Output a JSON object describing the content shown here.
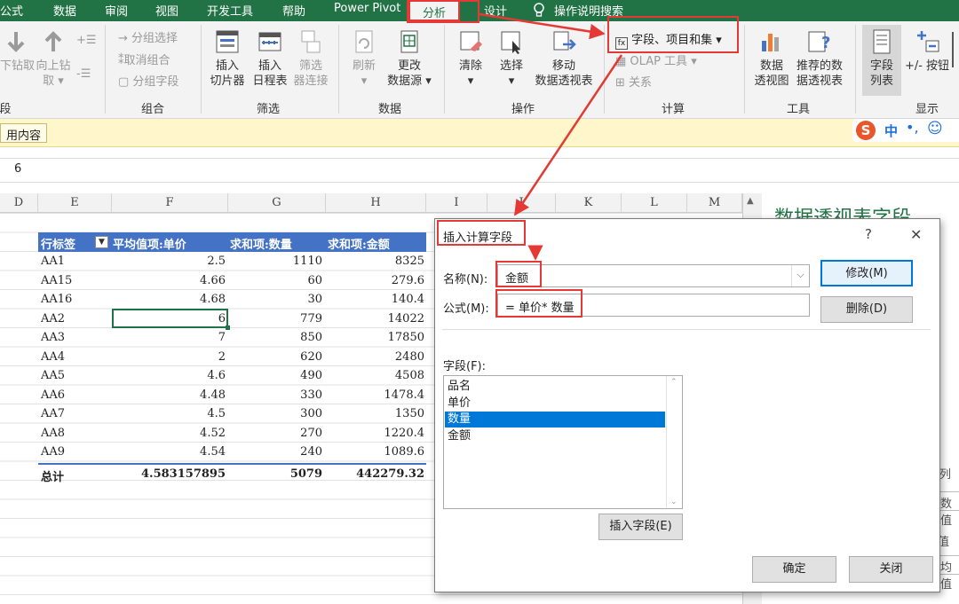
{
  "menu": {
    "tabs": [
      "公式",
      "数据",
      "审阅",
      "视图",
      "开发工具",
      "帮助",
      "Power Pivot",
      "分析",
      "设计"
    ],
    "active_tab": "分析",
    "tell_me": "操作说明搜索"
  },
  "ribbon": {
    "groups": {
      "g_left": "段",
      "group": "组合",
      "filter": "筛选",
      "data": "数据",
      "actions": "操作",
      "calc": "计算",
      "tools": "工具",
      "show": "显示"
    },
    "drill_down": "下钻取",
    "drill_up_1": "向上钻",
    "drill_up_2": "取 ▾",
    "group_selection": "→ 分组选择",
    "ungroup": "取消组合",
    "group_field": "分组字段",
    "insert_slicer_1": "插入",
    "insert_slicer_2": "切片器",
    "insert_timeline_1": "插入",
    "insert_timeline_2": "日程表",
    "filter_conn_1": "筛选",
    "filter_conn_2": "器连接",
    "refresh_1": "刷新",
    "refresh_2": "▾",
    "change_source_1": "更改",
    "change_source_2": "数据源 ▾",
    "clear_1": "清除",
    "clear_2": "▾",
    "select_1": "选择",
    "select_2": "▾",
    "move_1": "移动",
    "move_2": "数据透视表",
    "fields_items_sets": "字段、项目和集 ▾",
    "olap_tools": "OLAP 工具 ▾",
    "relationships": "关系",
    "pivotchart_1": "数据",
    "pivotchart_2": "透视图",
    "recommended_1": "推荐的数",
    "recommended_2": "据透视表",
    "field_list_1": "字段",
    "field_list_2": "列表",
    "plus_minus": "+/- 按钮"
  },
  "info_bar": {
    "text": "用内容",
    "ime": "中"
  },
  "formula_bar": {
    "value": "6"
  },
  "columns": [
    "D",
    "E",
    "F",
    "G",
    "H",
    "I",
    "J",
    "K",
    "L",
    "M"
  ],
  "pivot": {
    "headers": [
      "行标签",
      "平均值项:单价",
      "求和项:数量",
      "求和项:金额"
    ],
    "rows": [
      [
        "AA1",
        "2.5",
        "1110",
        "8325"
      ],
      [
        "AA15",
        "4.66",
        "60",
        "279.6"
      ],
      [
        "AA16",
        "4.68",
        "30",
        "140.4"
      ],
      [
        "AA2",
        "6",
        "779",
        "14022"
      ],
      [
        "AA3",
        "7",
        "850",
        "17850"
      ],
      [
        "AA4",
        "2",
        "620",
        "2480"
      ],
      [
        "AA5",
        "4.6",
        "490",
        "4508"
      ],
      [
        "AA6",
        "4.48",
        "330",
        "1478.4"
      ],
      [
        "AA7",
        "4.5",
        "300",
        "1350"
      ],
      [
        "AA8",
        "4.52",
        "270",
        "1220.4"
      ],
      [
        "AA9",
        "4.54",
        "240",
        "1089.6"
      ]
    ],
    "total": [
      "总计",
      "4.583157895",
      "5079",
      "442279.32"
    ]
  },
  "right_pane": {
    "title": "数据透视表字段",
    "frag_1": "列",
    "frag_2": "数值",
    "frag_3": "值",
    "frag_4": "均值"
  },
  "dialog": {
    "title": "插入计算字段",
    "help": "?",
    "close": "✕",
    "name_label": "名称(N):",
    "name_value": "金额",
    "formula_label": "公式(M):",
    "formula_value": "= 单价* 数量",
    "fields_label": "字段(F):",
    "fields": [
      "品名",
      "单价",
      "数量",
      "金额"
    ],
    "selected_field": "数量",
    "modify": "修改(M)",
    "delete": "删除(D)",
    "insert_field": "插入字段(E)",
    "ok": "确定",
    "cancel": "关闭"
  },
  "colors": {
    "excel_green": "#217346",
    "highlight_red": "#e53935",
    "pivot_blue": "#4472c4",
    "selection_blue": "#0078d7"
  }
}
